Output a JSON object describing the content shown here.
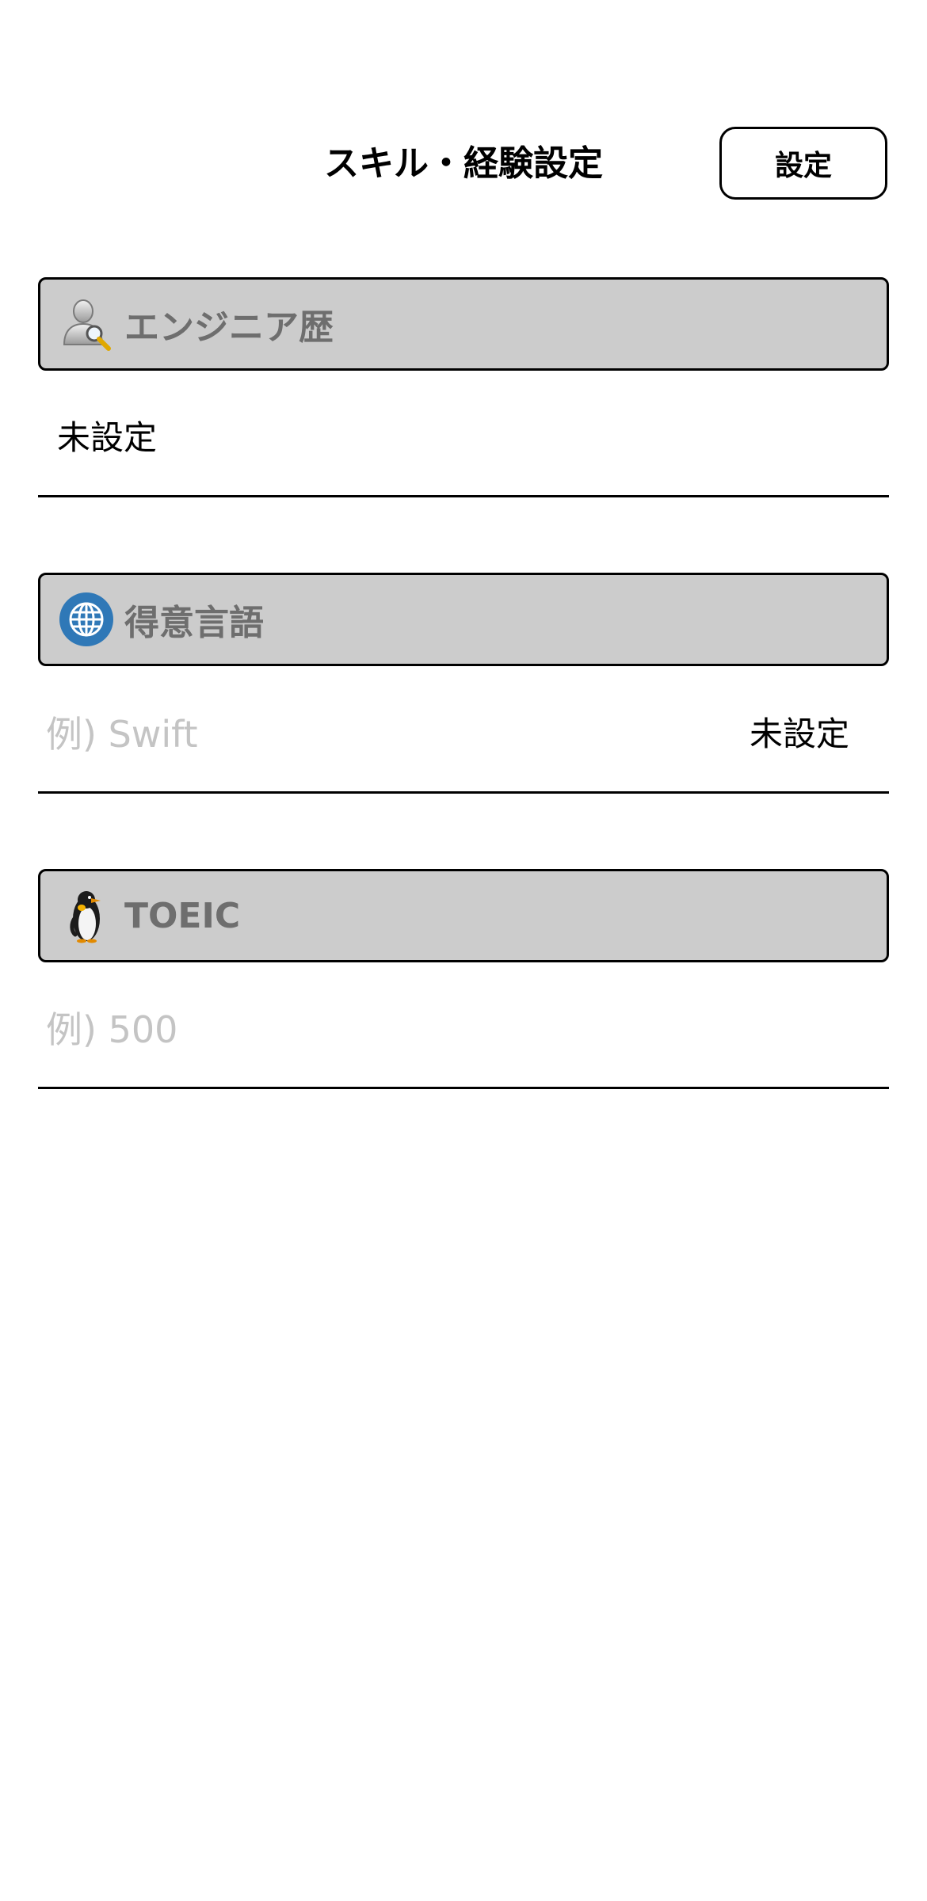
{
  "header": {
    "title": "スキル・経験設定",
    "settings_button_label": "設定"
  },
  "sections": {
    "experience": {
      "icon": "user-search-icon",
      "label": "エンジニア歴",
      "value": "未設定"
    },
    "language": {
      "icon": "globe-icon",
      "label": "得意言語",
      "placeholder": "例) Swift",
      "value": "",
      "status": "未設定"
    },
    "toeic": {
      "icon": "penguin-icon",
      "label": "TOEIC",
      "placeholder": "例) 500",
      "value": ""
    }
  },
  "colors": {
    "section_bg": "#cccccc",
    "section_label": "#6e6e6e",
    "placeholder": "#c4c4c4",
    "globe_blue": "#2f78b7"
  }
}
